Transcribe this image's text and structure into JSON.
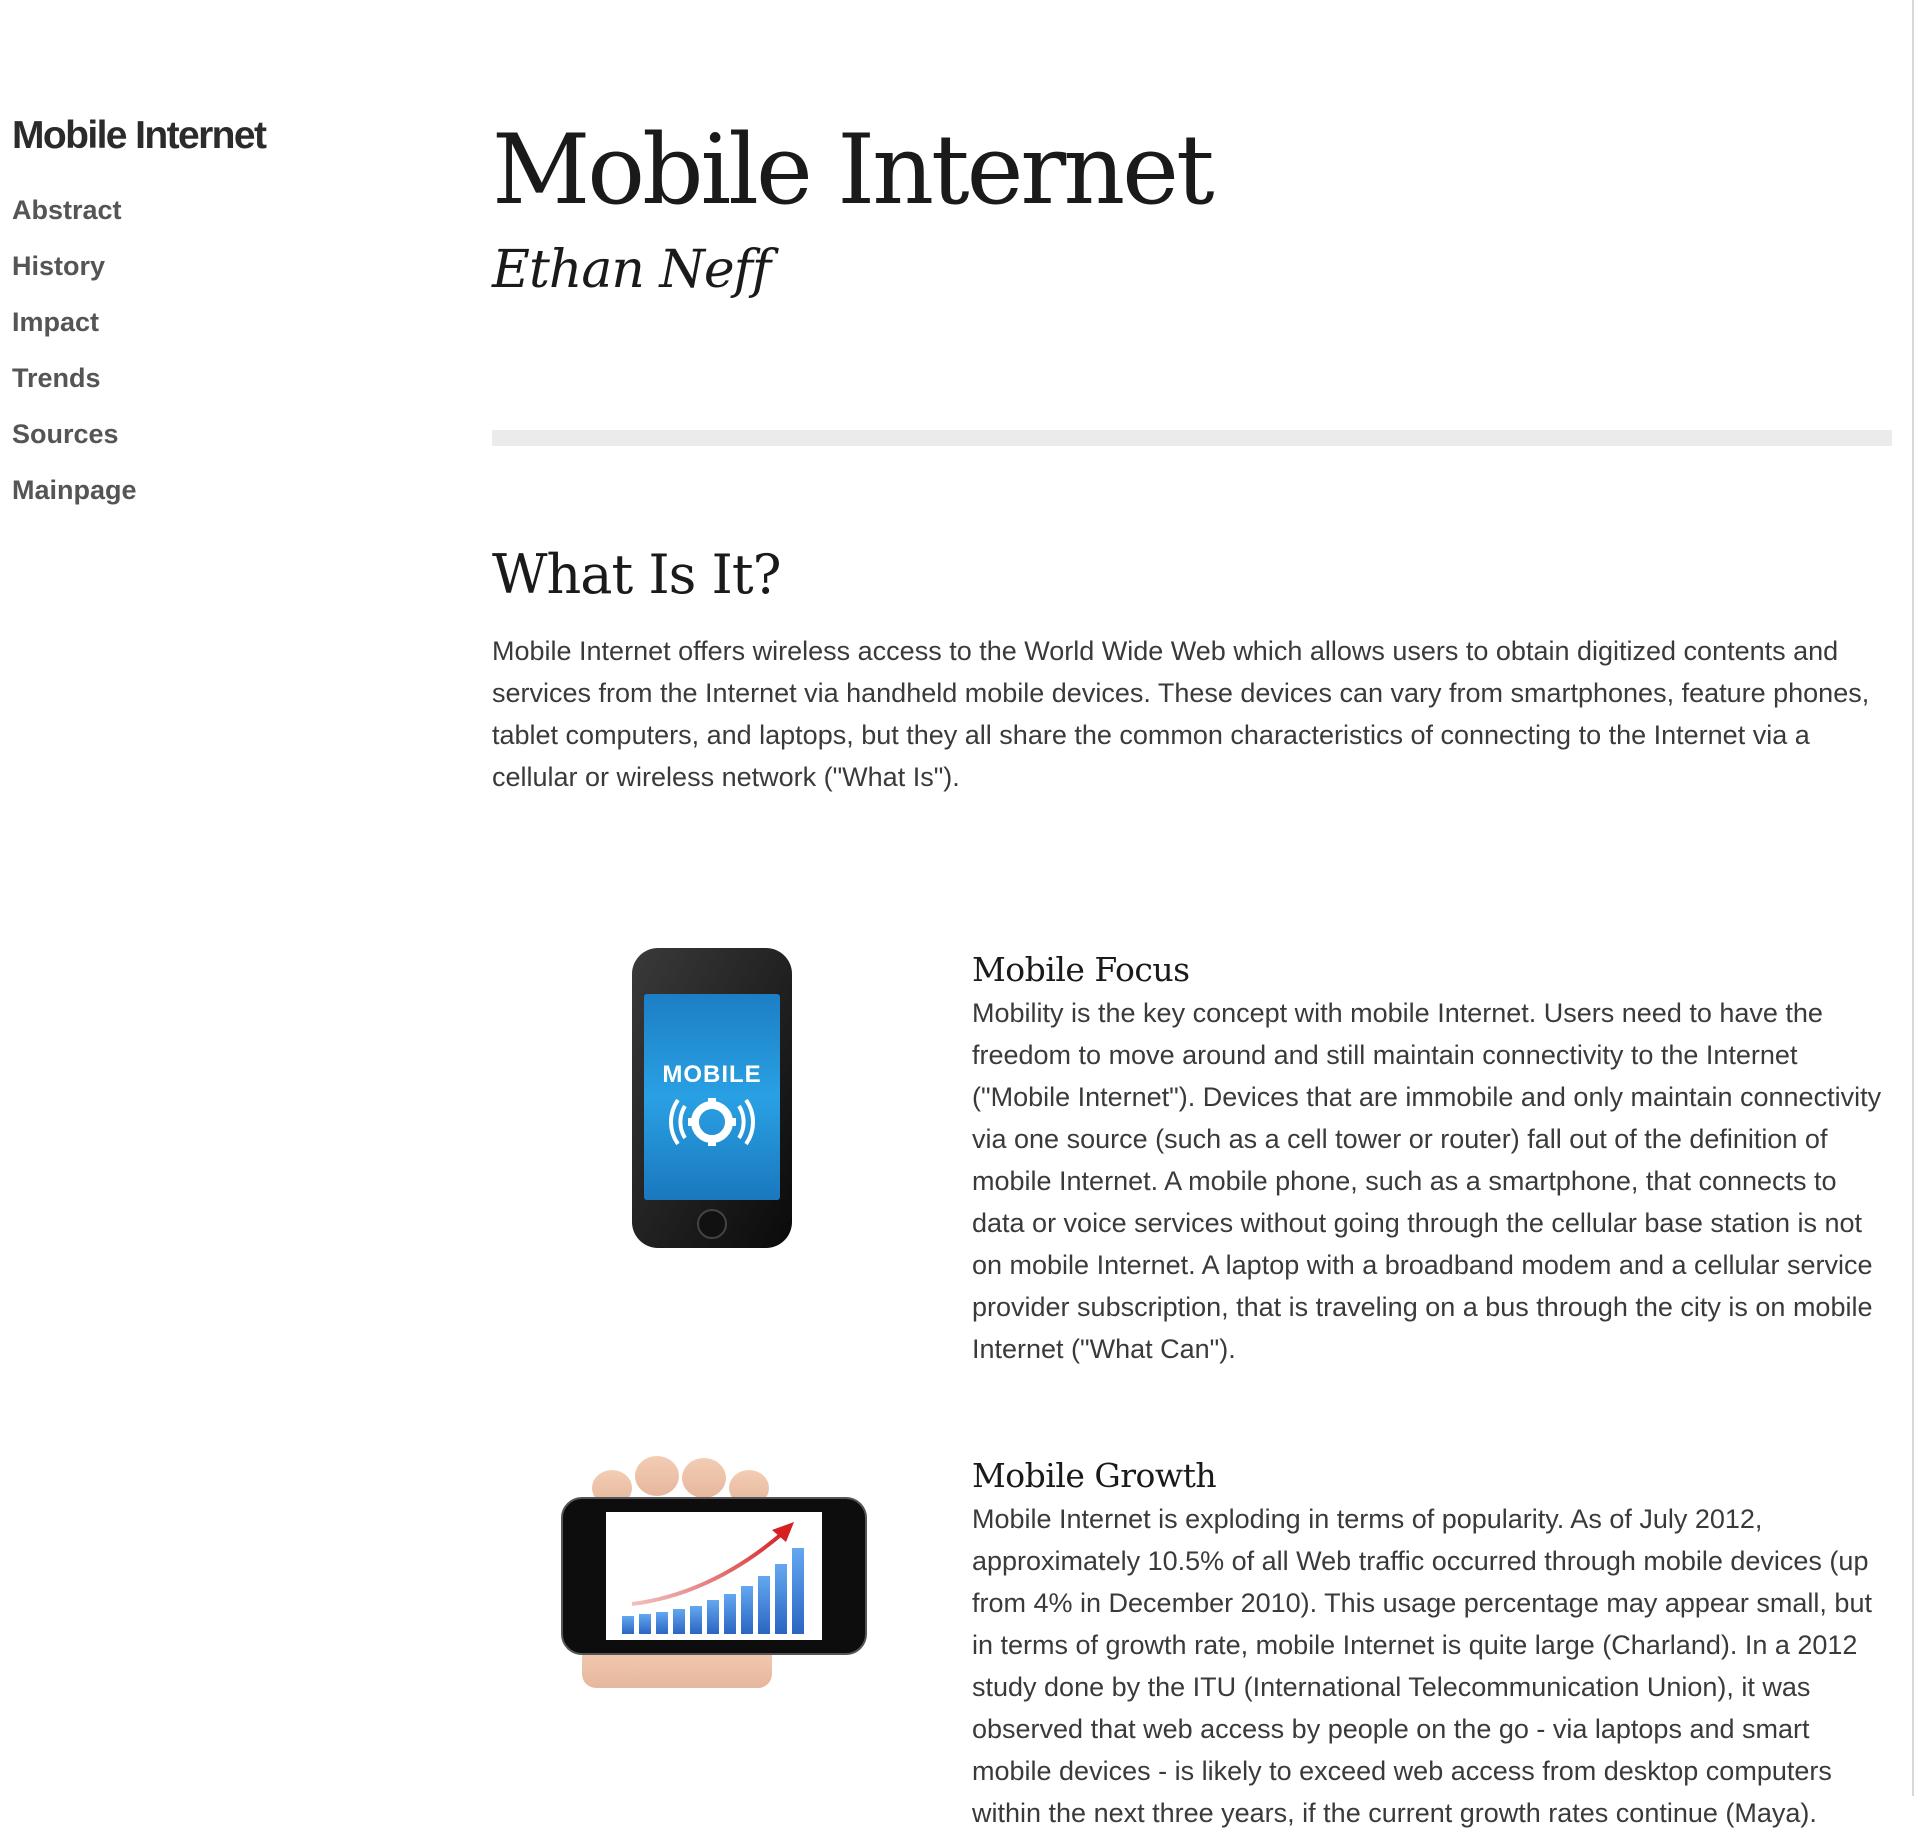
{
  "sidebar": {
    "site_title": "Mobile Internet",
    "nav": [
      {
        "label": "Abstract"
      },
      {
        "label": "History"
      },
      {
        "label": "Impact"
      },
      {
        "label": "Trends"
      },
      {
        "label": "Sources"
      },
      {
        "label": "Mainpage"
      }
    ]
  },
  "header": {
    "title": "Mobile Internet",
    "author": "Ethan Neff"
  },
  "section": {
    "heading": "What Is It?",
    "intro": "Mobile Internet offers wireless access to the World Wide Web which allows users to obtain digitized contents and services from the Internet via handheld mobile devices. These devices can vary from smartphones, feature phones, tablet computers, and laptops, but they all share the common characteristics of connecting to the Internet via a cellular or wireless network (\"What Is\")."
  },
  "features": [
    {
      "title": "Mobile Focus",
      "image_label": "MOBILE",
      "icon": "gear-signal-icon",
      "body": "Mobility is the key concept with mobile Internet. Users need to have the freedom to move around and still maintain connectivity to the Internet (\"Mobile Internet\"). Devices that are immobile and only maintain connectivity via one source (such as a cell tower or router) fall out of the definition of mobile Internet. A mobile phone, such as a smartphone, that connects to data or voice services without going through the cellular base station is not on mobile Internet. A laptop with a broadband modem and a cellular service provider subscription, that is traveling on a bus through the city is on mobile Internet (\"What Can\")."
    },
    {
      "title": "Mobile Growth",
      "icon": "growth-chart-phone-icon",
      "body": "Mobile Internet is exploding in terms of popularity. As of July 2012, approximately 10.5% of all Web traffic occurred through mobile devices (up from 4% in December 2010). This usage percentage may appear small, but in terms of growth rate, mobile Internet is quite large (Charland). In a 2012 study done by the ITU (International Telecommunication Union), it was observed that web access by people on the go - via laptops and smart mobile devices - is likely to exceed web access from desktop computers within the next three years, if the current growth rates continue (Maya)."
    }
  ],
  "colors": {
    "nav_text": "#555555",
    "body_text": "#3a3a3a",
    "heading_text": "#1a1a1a",
    "divider": "#ebebeb",
    "phone_screen": "#1e8ed3",
    "bar_blue": "#3b7fd6",
    "arrow_red": "#d42020"
  }
}
